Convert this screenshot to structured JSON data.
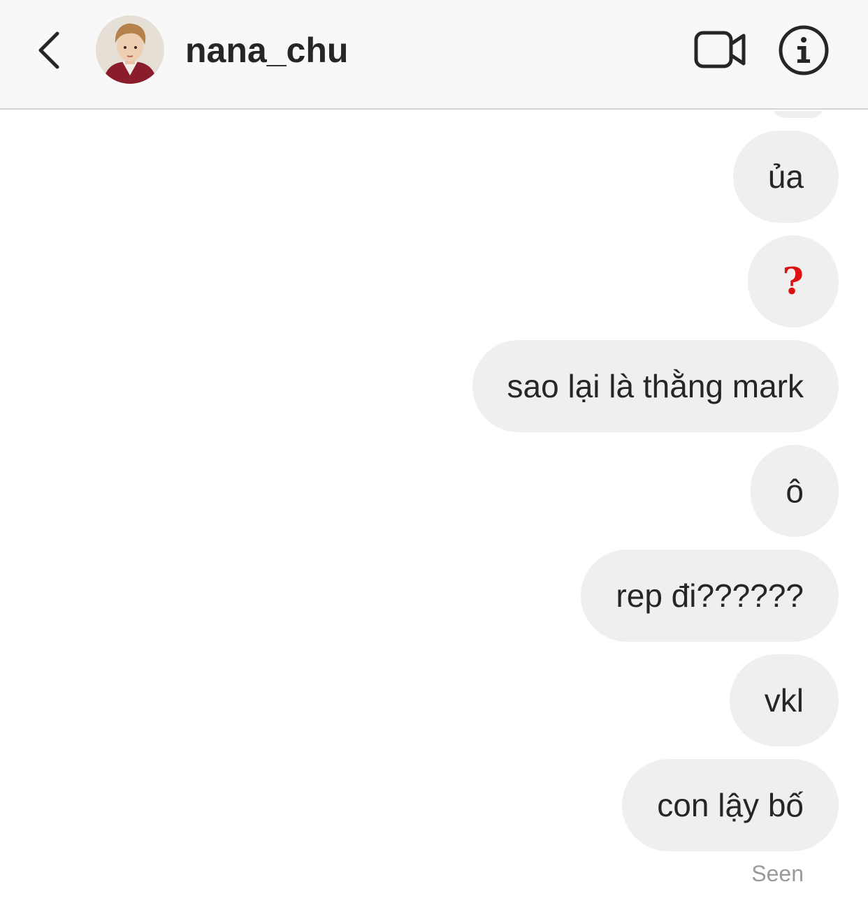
{
  "header": {
    "username": "nana_chu",
    "back_icon": "chevron-left-icon",
    "video_icon": "video-camera-icon",
    "info_icon": "info-circle-icon"
  },
  "messages": [
    {
      "text": "ủa"
    },
    {
      "text": "?"
    },
    {
      "text": "sao lại là thằng mark"
    },
    {
      "text": "ô"
    },
    {
      "text": "rep đi??????"
    },
    {
      "text": "vkl"
    },
    {
      "text": "con lậy bố"
    }
  ],
  "status": {
    "seen": "Seen"
  },
  "colors": {
    "bubble": "#efefef",
    "header_bg": "#f8f8f8",
    "question_mark": "#dd1111",
    "seen_text": "#9a9a9a"
  }
}
